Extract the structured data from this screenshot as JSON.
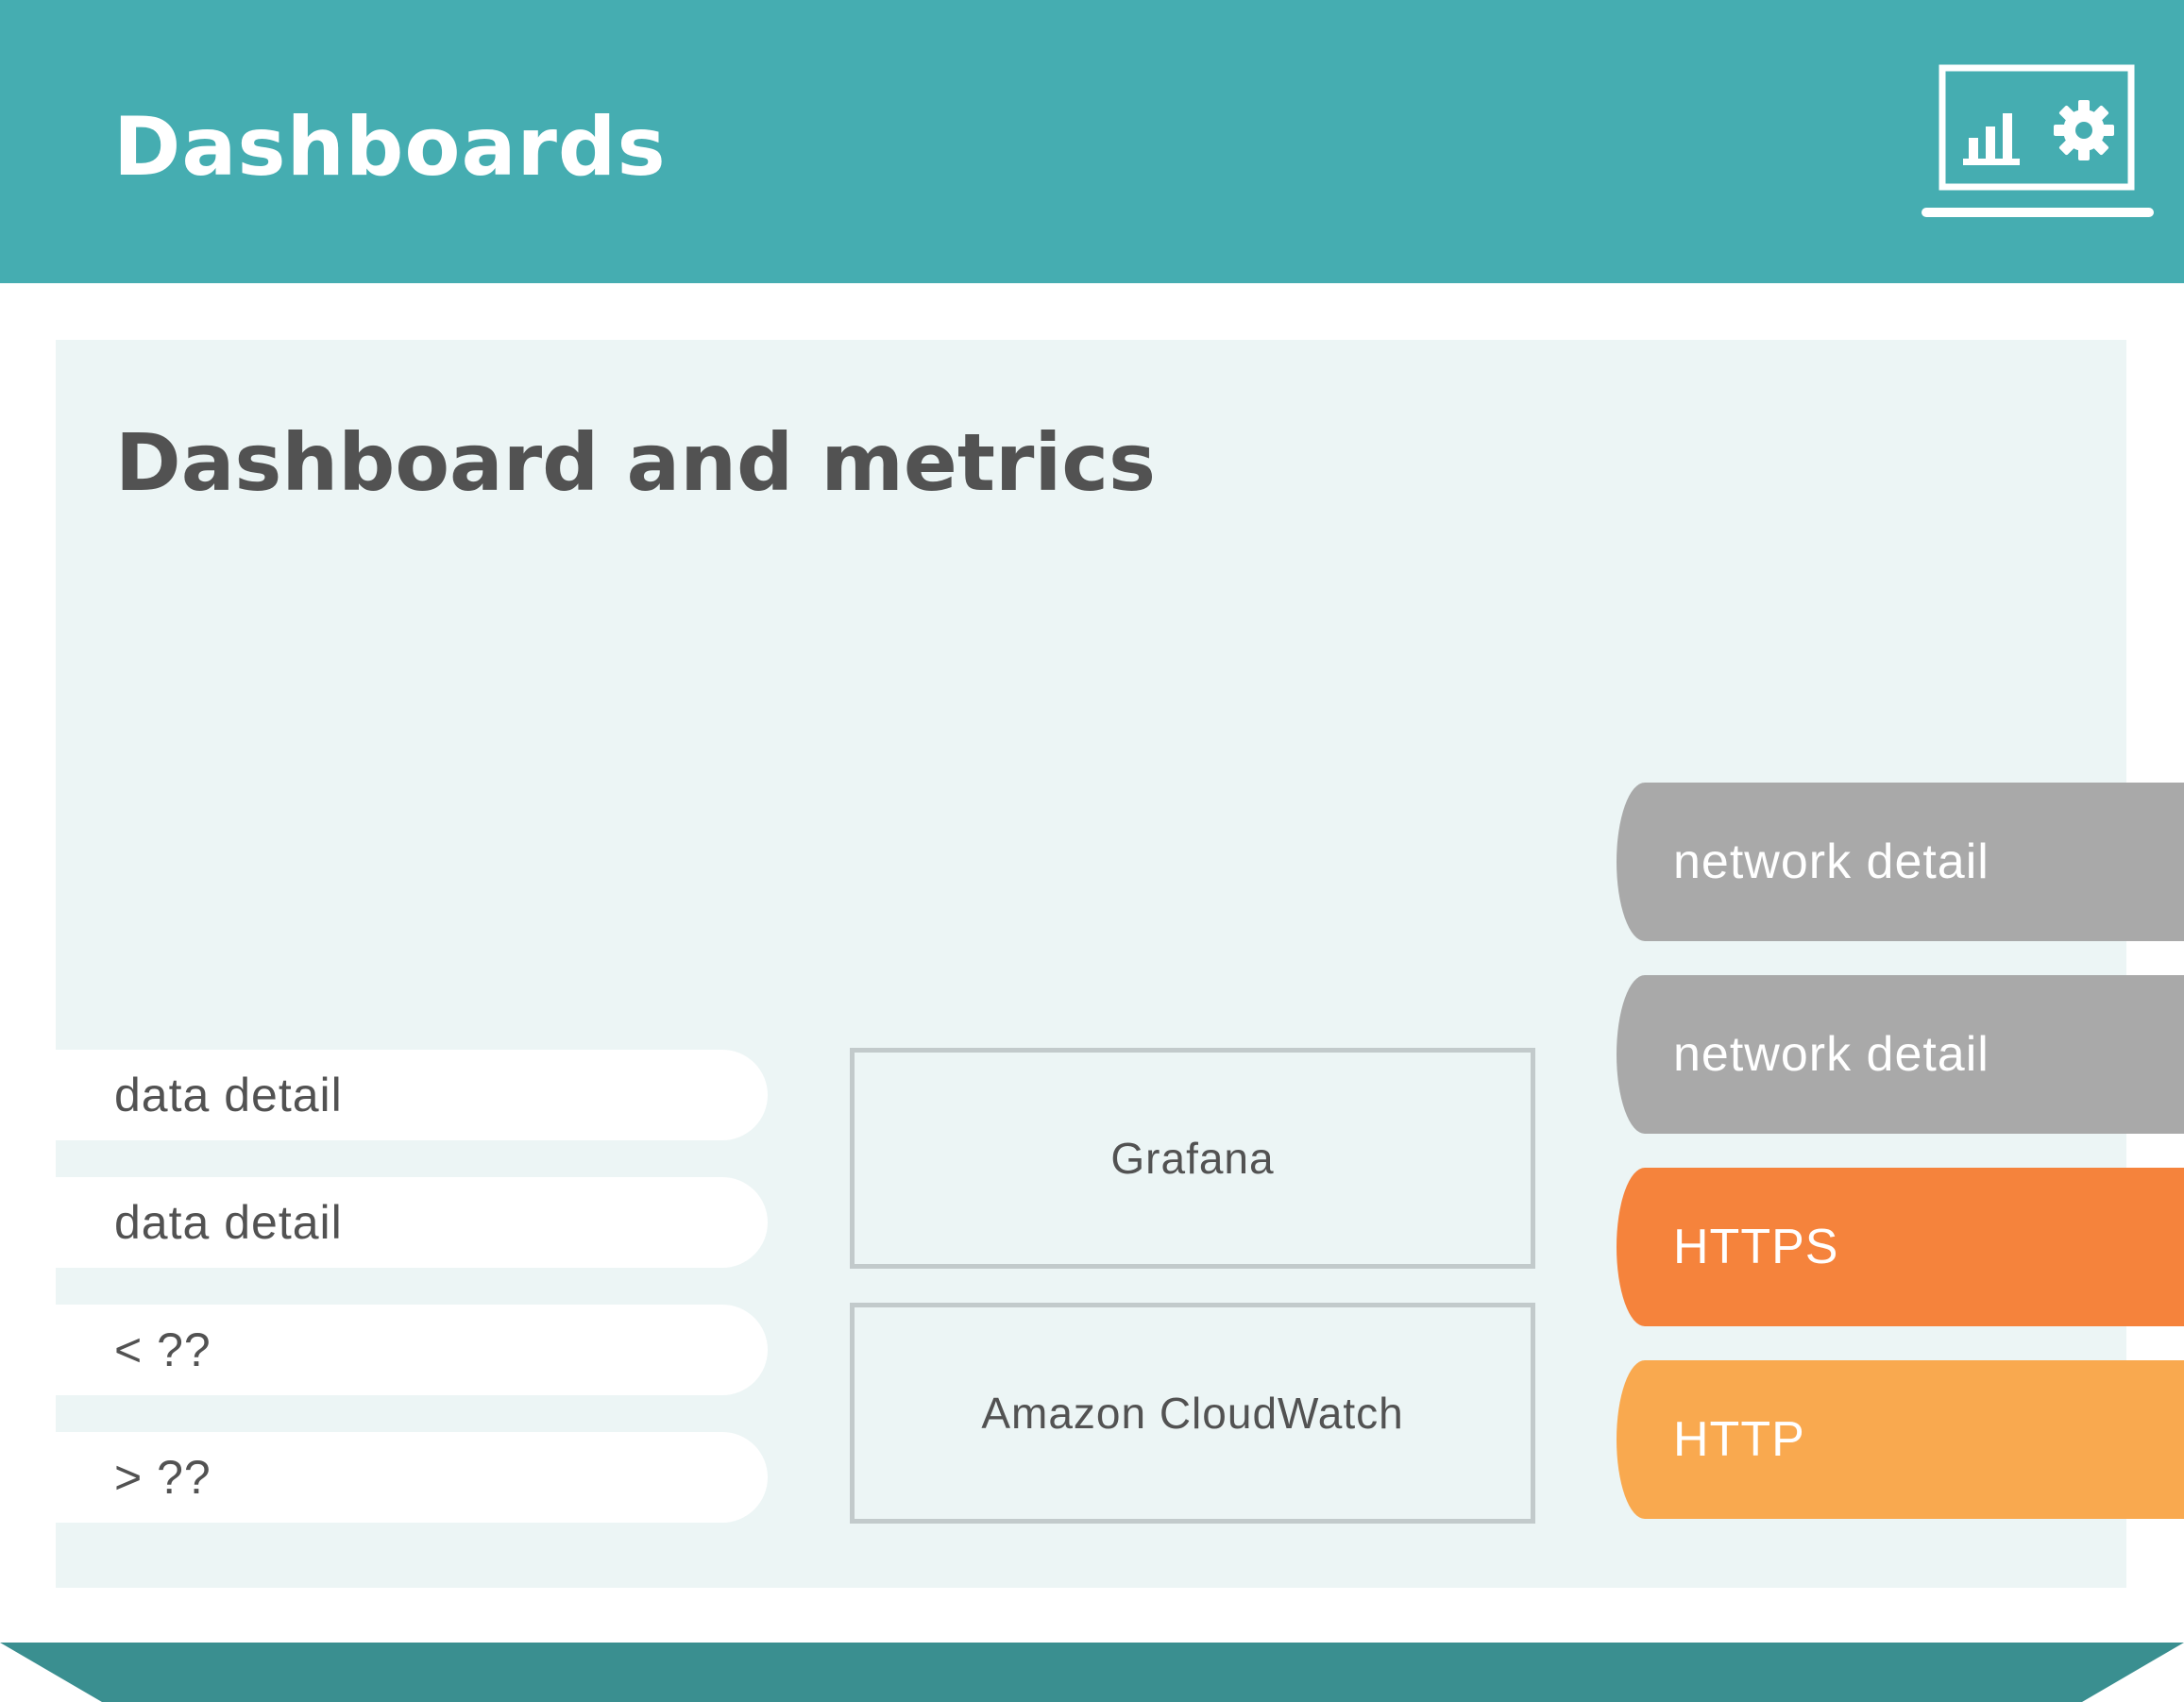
{
  "header": {
    "title": "Dashboards",
    "icon": "dashboard-monitor-icon",
    "background": "#45adb1"
  },
  "panel": {
    "title": "Dashboard and metrics",
    "background": "#ecf5f5"
  },
  "left_items": [
    "data detail",
    "data detail",
    "< ??",
    "> ??"
  ],
  "center_boxes": [
    "Grafana",
    "Amazon CloudWatch"
  ],
  "right_tabs": [
    {
      "label": "network detail",
      "color": "#a9a9a9"
    },
    {
      "label": "network detail",
      "color": "#a9a9a9"
    },
    {
      "label": "HTTPS",
      "color": "#f5833c"
    },
    {
      "label": "HTTP",
      "color": "#f9a94f"
    }
  ],
  "footer": {
    "color": "#3a8f90"
  }
}
